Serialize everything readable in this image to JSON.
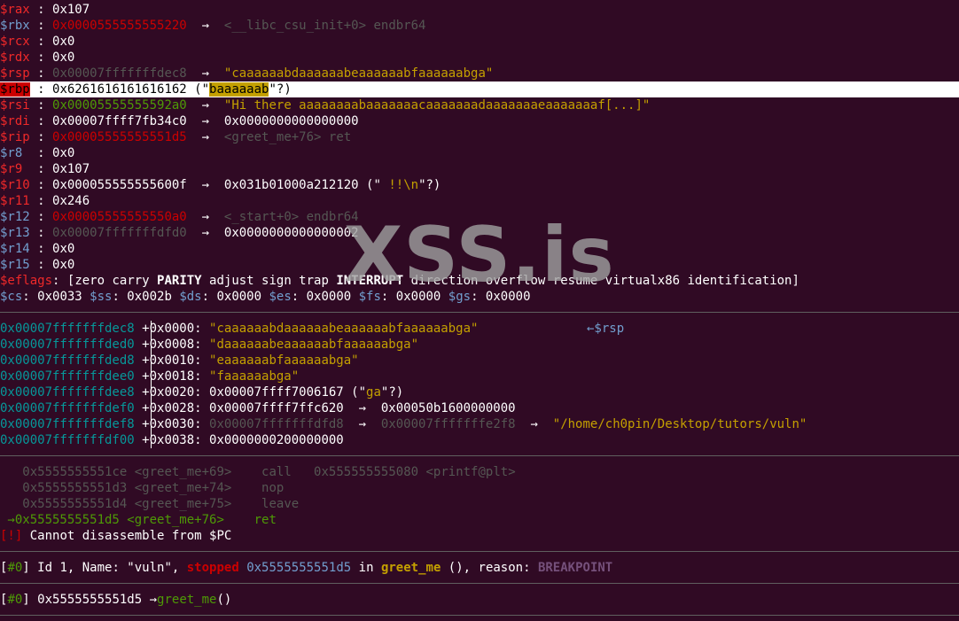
{
  "registers": [
    {
      "name": "$rax",
      "sep": " : ",
      "value": "0x107",
      "arrow": "",
      "target": "",
      "tclass": "",
      "cclass": "reg",
      "vclass": "wht"
    },
    {
      "name": "$rbx",
      "sep": " : ",
      "value": "0x0000555555555220",
      "arrow": "  →  ",
      "target": "<__libc_csu_init+0> endbr64",
      "tclass": "mute",
      "cclass": "regb",
      "vclass": "red"
    },
    {
      "name": "$rcx",
      "sep": " : ",
      "value": "0x0",
      "arrow": "",
      "target": "",
      "tclass": "",
      "cclass": "reg",
      "vclass": "wht"
    },
    {
      "name": "$rdx",
      "sep": " : ",
      "value": "0x0",
      "arrow": "",
      "target": "",
      "tclass": "",
      "cclass": "reg",
      "vclass": "wht"
    },
    {
      "name": "$rsp",
      "sep": " : ",
      "value": "0x00007fffffffdec8",
      "arrow": "  →  ",
      "target": "\"caaaaaabdaaaaaabeaaaaaabfaaaaaabga\"",
      "tclass": "yel",
      "cclass": "reg",
      "vclass": "mute"
    }
  ],
  "rbp": {
    "name": "$rbp",
    "sep": " : ",
    "value": "0x6261616161616162 (\"",
    "boxed": "baaaaaab",
    "tail": "\"?)"
  },
  "registers2": [
    {
      "name": "$rsi",
      "sep": " : ",
      "value": "0x00005555555592a0",
      "arrow": "  →  ",
      "target": "\"Hi there aaaaaaaabaaaaaaacaaaaaaadaaaaaaaeaaaaaaaf[...]\"",
      "tclass": "yel",
      "cclass": "reg",
      "vclass": "grn"
    },
    {
      "name": "$rdi",
      "sep": " : ",
      "value": "0x00007ffff7fb34c0",
      "arrow": "  →  ",
      "target": "0x0000000000000000",
      "tclass": "wht",
      "cclass": "reg",
      "vclass": "wht"
    },
    {
      "name": "$rip",
      "sep": " : ",
      "value": "0x00005555555551d5",
      "arrow": "  →  ",
      "target": "<greet_me+76> ret",
      "tclass": "mute",
      "cclass": "reg",
      "vclass": "red"
    },
    {
      "name": "$r8",
      "sep": "  : ",
      "value": "0x0",
      "arrow": "",
      "target": "",
      "tclass": "",
      "cclass": "regb",
      "vclass": "wht"
    },
    {
      "name": "$r9",
      "sep": "  : ",
      "value": "0x107",
      "arrow": "",
      "target": "",
      "tclass": "",
      "cclass": "reg",
      "vclass": "wht"
    },
    {
      "name": "$r10",
      "sep": " : ",
      "value": "0x000055555555600f",
      "arrow": "  →  ",
      "target": "0x031b01000a212120 (\"",
      "tclass": "wht",
      "cclass": "reg",
      "vclass": "wht",
      "extra": " !!\\n",
      "extraclass": "yel",
      "extra2": "\"?)"
    },
    {
      "name": "$r11",
      "sep": " : ",
      "value": "0x246",
      "arrow": "",
      "target": "",
      "tclass": "",
      "cclass": "reg",
      "vclass": "wht"
    },
    {
      "name": "$r12",
      "sep": " : ",
      "value": "0x00005555555550a0",
      "arrow": "  →  ",
      "target": "<_start+0> endbr64",
      "tclass": "mute",
      "cclass": "regb",
      "vclass": "red"
    },
    {
      "name": "$r13",
      "sep": " : ",
      "value": "0x00007fffffffdfd0",
      "arrow": "  →  ",
      "target": "0x0000000000000002",
      "tclass": "wht",
      "cclass": "regb",
      "vclass": "mute"
    },
    {
      "name": "$r14",
      "sep": " : ",
      "value": "0x0",
      "arrow": "",
      "target": "",
      "tclass": "",
      "cclass": "regb",
      "vclass": "wht"
    },
    {
      "name": "$r15",
      "sep": " : ",
      "value": "0x0",
      "arrow": "",
      "target": "",
      "tclass": "",
      "cclass": "regb",
      "vclass": "wht"
    }
  ],
  "eflags": {
    "label": "$eflags",
    "sep": ": [",
    "f1": "zero carry ",
    "f2": "PARITY",
    "f3": " adjust sign trap ",
    "f4": "INTERRUPT",
    "f5": " direction overflow resume virtualx86 identification]"
  },
  "segments": [
    {
      "name": "$cs",
      "value": ": 0x0033 "
    },
    {
      "name": "$ss",
      "value": ": 0x002b "
    },
    {
      "name": "$ds",
      "value": ": 0x0000 "
    },
    {
      "name": "$es",
      "value": ": 0x0000 "
    },
    {
      "name": "$fs",
      "value": ": 0x0000 "
    },
    {
      "name": "$gs",
      "value": ": 0x0000"
    }
  ],
  "stack": [
    {
      "addr": "0x00007fffffffdec8",
      "off": "+0x0000: ",
      "content": "\"caaaaaabdaaaaaabeaaaaaabfaaaaaabga\"",
      "cclass": "yel",
      "note": "←$rsp"
    },
    {
      "addr": "0x00007fffffffded0",
      "off": "+0x0008: ",
      "content": "\"daaaaaabeaaaaaabfaaaaaabga\"",
      "cclass": "yel",
      "note": ""
    },
    {
      "addr": "0x00007fffffffded8",
      "off": "+0x0010: ",
      "content": "\"eaaaaaabfaaaaaabga\"",
      "cclass": "yel",
      "note": ""
    },
    {
      "addr": "0x00007fffffffdee0",
      "off": "+0x0018: ",
      "content": "\"faaaaaabga\"",
      "cclass": "yel",
      "note": ""
    },
    {
      "addr": "0x00007fffffffdee8",
      "off": "+0x0020: ",
      "content": "0x00007ffff7006167 (\"",
      "cclass": "wht",
      "note": "",
      "x1": "ga",
      "x2": "\"?)"
    },
    {
      "addr": "0x00007fffffffdef0",
      "off": "+0x0028: ",
      "content": "0x00007ffff7ffc620  →  0x00050b1600000000",
      "cclass": "wht",
      "note": ""
    },
    {
      "addr": "0x00007fffffffdef8",
      "off": "+0x0030: ",
      "content": "0x00007fffffffdfd8",
      "cclass": "mute",
      "note": "",
      "a1": "  →  ",
      "a2": "0x00007fffffffe2f8",
      "a3": "  →  ",
      "a4": "\"/home/ch0pin/Desktop/tutors/vuln\""
    },
    {
      "addr": "0x00007fffffffdf00",
      "off": "+0x0038: ",
      "content": "0x0000000200000000",
      "cclass": "wht",
      "note": ""
    }
  ],
  "disasm": [
    {
      "arrow": "   ",
      "addr": "0x5555555551ce",
      "sym": " <greet_me+69>",
      "gap": "    ",
      "ins": "call   0x555555555080 <printf@plt>",
      "cls": "mute"
    },
    {
      "arrow": "   ",
      "addr": "0x5555555551d3",
      "sym": " <greet_me+74>",
      "gap": "    ",
      "ins": "nop",
      "cls": "mute"
    },
    {
      "arrow": "   ",
      "addr": "0x5555555551d4",
      "sym": " <greet_me+75>",
      "gap": "    ",
      "ins": "leave",
      "cls": "mute"
    },
    {
      "arrow": " →",
      "addr": "0x5555555551d5",
      "sym": " <greet_me+76>",
      "gap": "    ",
      "ins": "ret",
      "cls": "grn"
    }
  ],
  "error": {
    "badge": "[!]",
    "text": " Cannot disassemble from $PC"
  },
  "threads": {
    "open": "[",
    "num": "#0",
    "close": "]",
    "t1": " Id 1, Name: \"vuln\", ",
    "status": "stopped",
    "t2": " ",
    "addr": "0x5555555551d5",
    "t3": " in ",
    "func": "greet_me",
    "t4": " (), reason: ",
    "reason": "BREAKPOINT"
  },
  "trace": {
    "open": "[",
    "num": "#0",
    "close": "]",
    "t1": " 0x5555555551d5 →",
    "func": "greet_me",
    "t2": "()"
  },
  "watermark": "XSS.is"
}
